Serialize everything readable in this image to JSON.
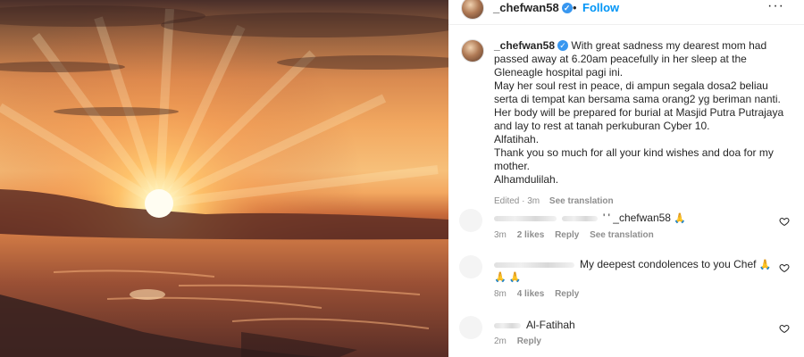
{
  "post": {
    "username": "_chefwan58",
    "verified_icon": "verified-badge-icon",
    "follow_label": "Follow",
    "more_icon": "more-options-icon",
    "separator": "•"
  },
  "caption": {
    "username": "_chefwan58",
    "lines": [
      "With great sadness my dearest mom had passed away at 6.20am peacefully in her sleep at the Gleneagle hospital pagi ini.",
      "May her soul rest in peace, di ampun segala dosa2 beliau serta di tempat kan bersama sama orang2 yg beriman nanti.",
      "Her body will be prepared for burial at Masjid Putra Putrajaya and lay to rest at tanah perkuburan Cyber 10.",
      "Alfatihah.",
      "Thank you so much for all your kind wishes and doa for my mother.",
      "Alhamdulilah."
    ],
    "edited": "Edited · 3m",
    "see_translation": "See translation"
  },
  "comments": [
    {
      "text": "_chefwan58",
      "prefix": "' '",
      "emoji": "🙏",
      "time": "3m",
      "likes": "2 likes",
      "reply": "Reply",
      "see_translation": "See translation"
    },
    {
      "text": "My deepest condolences to you Chef",
      "emoji": "🙏",
      "emoji_line": "🙏 🙏",
      "time": "8m",
      "likes": "4 likes",
      "reply": "Reply"
    },
    {
      "text": "Al-Fatihah",
      "time": "2m",
      "reply": "Reply"
    }
  ],
  "colors": {
    "link_blue": "#0095f6",
    "verified_blue": "#3897f0",
    "muted_gray": "#8e8e8e",
    "text": "#262626"
  }
}
